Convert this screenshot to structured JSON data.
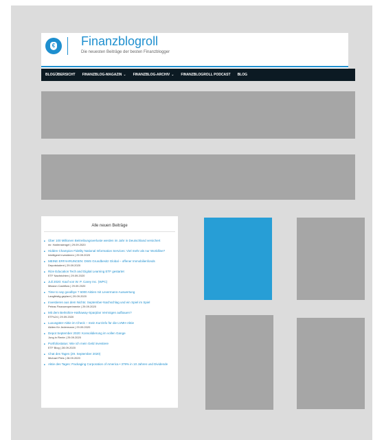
{
  "header": {
    "site_title": "Finanzblogroll",
    "tagline": "Die neuesten Beiträge der besten Finanzblogger",
    "logo_symbol": "€",
    "accent": "#1e8fcf"
  },
  "nav": {
    "items": [
      {
        "label": "BLOGÜBERSICHT",
        "chevron": ""
      },
      {
        "label": "FINANZBLOG-MAGAZIN",
        "chevron": "⌄"
      },
      {
        "label": "FINANZBLOG-ARCHIV",
        "chevron": "⌄"
      },
      {
        "label": "FINANZBLOGROLL PODCAST",
        "chevron": ""
      },
      {
        "label": "BLOG",
        "chevron": ""
      }
    ]
  },
  "widget": {
    "title": "Alle neuen Beiträge",
    "posts": [
      {
        "title": "Über 100 Millionen Beitreibungsverluste werden im Jahr in Deutschland versichert",
        "meta": "mr. Harlenstengel | 29.09.2020"
      },
      {
        "title": "Hidden Champion Fidelity National Information Services: Viel mehr als nur Worldline?",
        "meta": "Intelligent Investieren | 29.09.2020"
      },
      {
        "title": "MEINE ERFAHRUNGEN: DWS Grundbesitz Global – offener Immobilienfonds",
        "meta": "Depotstudent | 29.09.2020"
      },
      {
        "title": "Rize Education Tech and Digital Learning ETF gestartet",
        "meta": "ETF Nachrichten | 29.09.2020"
      },
      {
        "title": "Juli 2020: Kauf von W. P. Carey Inc. (WPC)",
        "meta": "Mission Cashflow | 29.09.2020"
      },
      {
        "title": "Time to say goodbye ? 6000 Aktien mit Levermann-Auswertung",
        "meta": "Langfristig.geplant | 29.09.2020"
      },
      {
        "title": "Investieren aus dem Nichts: September-Nachschlag und ein Spiel im Spiel",
        "meta": "Petras Finanzexperimente | 29.09.2020"
      },
      {
        "title": "Mit dem Berkshire-Hathaway-Sparplan Vermögen aufbauen?",
        "meta": "ETFs24 | 29.09.2020"
      },
      {
        "title": "Luxusgüter-Aktie im Check – mein Kurzinfo für die LVMH-Aktie",
        "meta": "Aktien für Jedermann | 29.09.2020"
      },
      {
        "title": "Depot September 2020: Konsolidierung im vollen Gange",
        "meta": "Jung in Rente | 29.09.2020"
      },
      {
        "title": "Portfoliostatus: Wie ich mein Geld investiere",
        "meta": "ETF Blog | 28.09.2020"
      },
      {
        "title": "Chat des Tages (29. September 2020)",
        "meta": "Michael Pleis | 28.09.2020"
      },
      {
        "title": "Aktie des Tages: Packaging Corporation of America • 379% in 10 Jahren und Dividende",
        "meta": ""
      }
    ]
  },
  "colors": {
    "background": "#dcdcdc",
    "placeholder": "#a6a6a6",
    "highlight_box": "#279ed6",
    "nav_bg": "#0c1a23"
  }
}
